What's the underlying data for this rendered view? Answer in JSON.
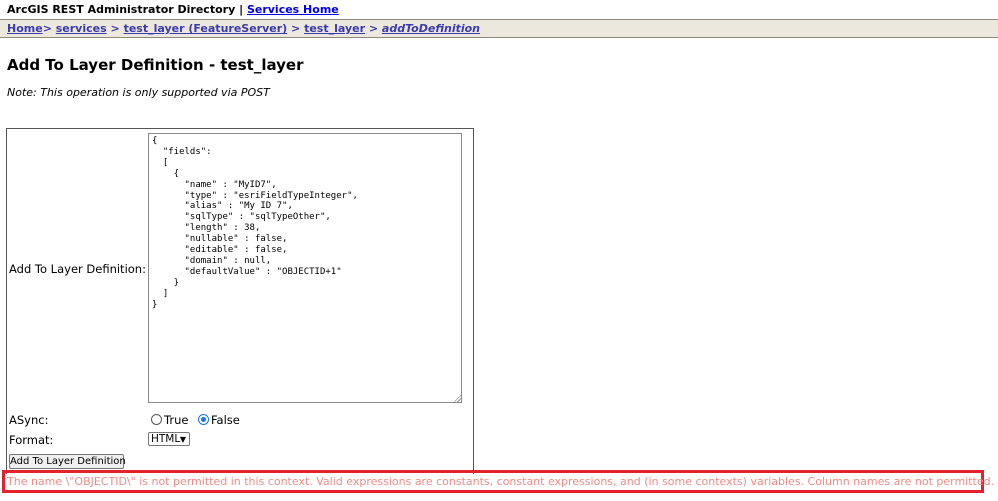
{
  "header": {
    "title": "ArcGIS REST Administrator Directory",
    "separator": "|",
    "services_home_link": "Services Home"
  },
  "breadcrumb": {
    "items": [
      "Home",
      "services",
      "test_layer (FeatureServer)",
      "test_layer",
      "addToDefinition"
    ],
    "separator": ">"
  },
  "page": {
    "title": "Add To Layer Definition - test_layer",
    "note": "Note: This operation is only supported via POST"
  },
  "form": {
    "definition_label": "Add To Layer Definition:",
    "definition_value": "{\n  \"fields\":\n  [\n    {\n      \"name\" : \"MyID7\",\n      \"type\" : \"esriFieldTypeInteger\",\n      \"alias\" : \"My ID 7\",\n      \"sqlType\" : \"sqlTypeOther\",\n      \"length\" : 38,\n      \"nullable\" : false,\n      \"editable\" : false,\n      \"domain\" : null,\n      \"defaultValue\" : \"OBJECTID+1\"\n    }\n  ]\n}",
    "async_label": "ASync:",
    "async_true_label": "True",
    "async_false_label": "False",
    "async_selected": "False",
    "format_label": "Format:",
    "format_selected": "HTML",
    "submit_label": "Add To Layer Definition"
  },
  "error": {
    "message": "The name \\\"OBJECTID\\\" is not permitted in this context. Valid expressions are constants, constant expressions, and (in some contexts) variables. Column names are not permitted.",
    "color": "#f08a8a",
    "highlight_color": "#e2222c"
  }
}
